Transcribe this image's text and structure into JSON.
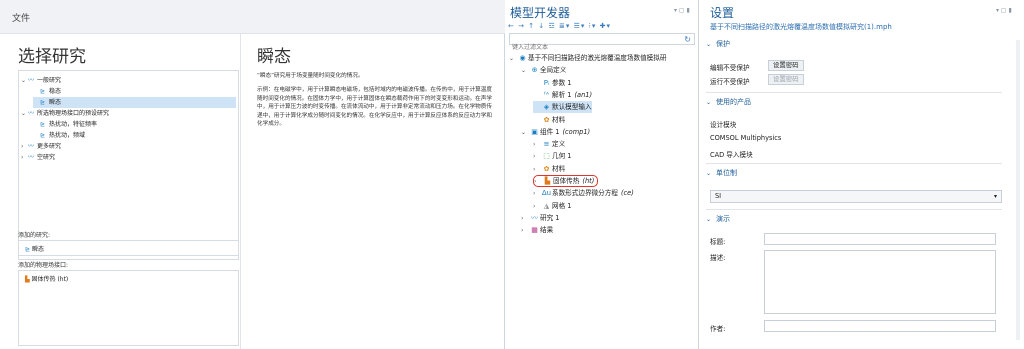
{
  "wizard": {
    "title": "文件",
    "select_study_heading": "选择研究",
    "study_title": "瞬态",
    "tree": [
      {
        "label": "一般研究",
        "level": 0,
        "expanded": true
      },
      {
        "label": "稳态",
        "level": 1
      },
      {
        "label": "瞬态",
        "level": 1,
        "selected": true
      },
      {
        "label": "所选物理场接口的预设研究",
        "level": 0,
        "expanded": true
      },
      {
        "label": "热扰动，特征频率",
        "level": 1
      },
      {
        "label": "热扰动，频域",
        "level": 1
      },
      {
        "label": "更多研究",
        "level": 0
      },
      {
        "label": "空研究",
        "level": 0
      }
    ],
    "description_short": "“瞬态”研究用于场变量随时间变化的情况。",
    "description_long": "示例：在电磁学中，用于计算瞬态电磁场，包括时域内的电磁波传播。在传热中，用于计算温度随时间变化的情况。在固体力学中，用于计算固体在瞬态载荷作用下的时变变形和运动。在声学中，用于计算压力波的时变传播。在流体流动中，用于计算非定常流动和压力场。在化学物质传递中，用于计算化学成分随时间变化的情况。在化学反应中，用于计算反应体系的反应动力学和化学成分。",
    "added_studies_label": "添加的研究:",
    "added_study": "瞬态",
    "added_physics_label": "添加的物理场接口:",
    "added_physics": "固体传热 (ht)"
  },
  "builder": {
    "title": "模型开发器",
    "filter_placeholder": "键入过滤文本",
    "toolbar_icons": [
      "arrow-left-icon",
      "arrow-right-icon",
      "arrow-up-icon",
      "arrow-down-icon",
      "show-icon",
      "collapse-icon",
      "expand-icon",
      "settings-icon",
      "add-icon"
    ],
    "tree": [
      {
        "label": "基于不同扫描路径的激光熔覆温度场数值模拟研",
        "level": 0,
        "caret": "⌄",
        "icon": "◉",
        "color": "#1a7fc1"
      },
      {
        "label": "全局定义",
        "level": 1,
        "caret": "⌄",
        "icon": "⊕",
        "color": "#1a7fc1"
      },
      {
        "label": "参数 1",
        "level": 2,
        "caret": "",
        "icon": "Pᵢ",
        "color": "#1a7fc1"
      },
      {
        "label": "解析 1",
        "tag": "(an1)",
        "level": 2,
        "caret": "",
        "icon": "ᶠᴬ",
        "color": "#1a7fc1"
      },
      {
        "label": "默认模型输入",
        "level": 2,
        "caret": "",
        "icon": "◈",
        "color": "#1a7fc1",
        "selected": true
      },
      {
        "label": "材料",
        "level": 2,
        "caret": "",
        "icon": "✿",
        "color": "#d98a1e"
      },
      {
        "label": "组件 1",
        "tag": "(comp1)",
        "level": 1,
        "caret": "⌄",
        "icon": "▣",
        "color": "#1a7fc1"
      },
      {
        "label": "定义",
        "level": 2,
        "caret": "›",
        "icon": "≡",
        "color": "#1a7fc1"
      },
      {
        "label": "几何 1",
        "level": 2,
        "caret": "›",
        "icon": "⬚",
        "color": "#3a9a3a"
      },
      {
        "label": "材料",
        "level": 2,
        "caret": "›",
        "icon": "✿",
        "color": "#d98a1e"
      },
      {
        "label": "固体传热",
        "tag": "(ht)",
        "level": 2,
        "caret": "›",
        "icon": "▙",
        "color": "#e07a1a",
        "highlight": true
      },
      {
        "label": "系数形式边界微分方程",
        "tag": "(ce)",
        "level": 2,
        "caret": "›",
        "icon": "Δu",
        "color": "#1a7fc1"
      },
      {
        "label": "网格 1",
        "level": 2,
        "caret": "›",
        "icon": "◮",
        "color": "#888888"
      },
      {
        "label": "研究 1",
        "level": 1,
        "caret": "›",
        "icon": "〰",
        "color": "#1a7fc1"
      },
      {
        "label": "结果",
        "level": 1,
        "caret": "›",
        "icon": "▦",
        "color": "#b03a8a"
      }
    ]
  },
  "settings": {
    "title": "设置",
    "subtitle": "基于不同扫描路径的激光熔覆温度场数值模拟研究(1).mph",
    "protection": {
      "section": "保护",
      "edit_label": "编辑不受保护",
      "edit_button": "设置密码",
      "run_label": "运行不受保护",
      "run_button": "设置密码"
    },
    "products": {
      "section": "使用的产品",
      "items": [
        "设计模块",
        "COMSOL Multiphysics",
        "CAD 导入模块"
      ]
    },
    "units": {
      "section": "单位制",
      "value": "SI"
    },
    "presentation": {
      "section": "演示",
      "title_label": "标题:",
      "description_label": "描述:",
      "author_label": "作者:"
    }
  }
}
